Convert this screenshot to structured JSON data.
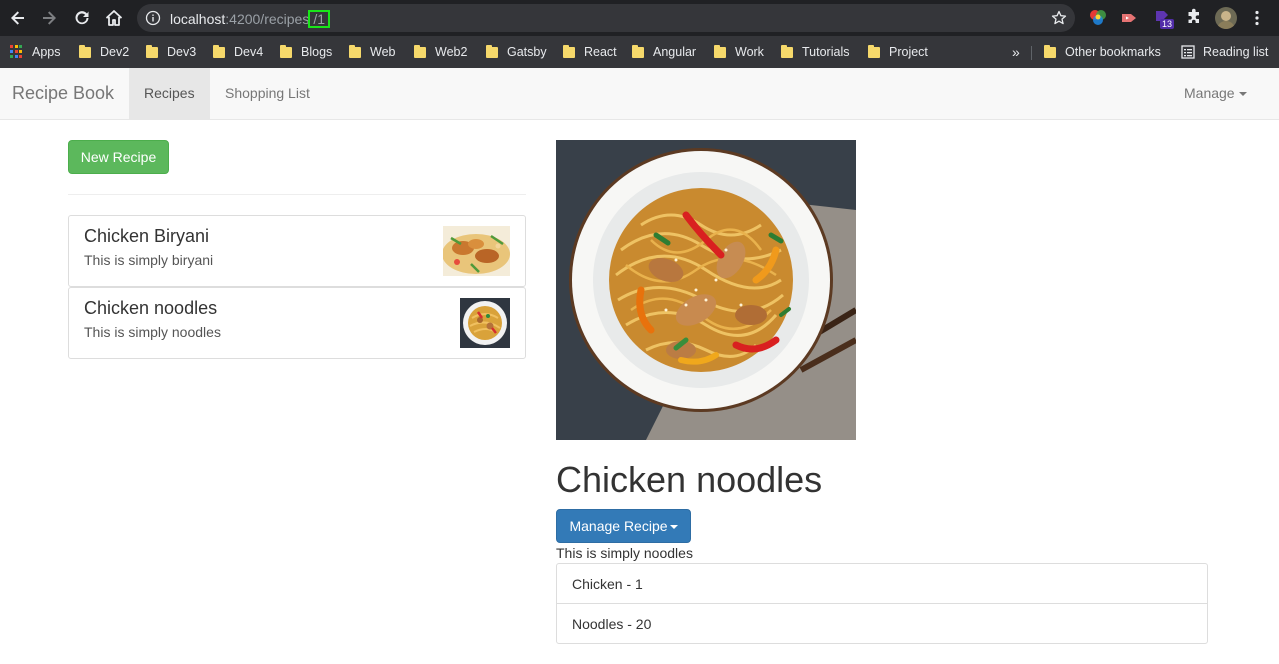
{
  "browser": {
    "url_host": "localhost",
    "url_path": ":4200/recipes",
    "url_highlight": "/1",
    "extension_badge": "13"
  },
  "bookmarks": {
    "apps": "Apps",
    "items": [
      "Dev2",
      "Dev3",
      "Dev4",
      "Blogs",
      "Web",
      "Web2",
      "Gatsby",
      "React",
      "Angular",
      "Work",
      "Tutorials",
      "Project"
    ],
    "overflow": "»",
    "other": "Other bookmarks",
    "reading_list": "Reading list"
  },
  "navbar": {
    "brand": "Recipe Book",
    "links": [
      "Recipes",
      "Shopping List"
    ],
    "manage": "Manage"
  },
  "recipes": {
    "new_button": "New Recipe",
    "items": [
      {
        "name": "Chicken Biryani",
        "description": "This is simply biryani"
      },
      {
        "name": "Chicken noodles",
        "description": "This is simply noodles"
      }
    ]
  },
  "detail": {
    "title": "Chicken noodles",
    "manage_button": "Manage Recipe",
    "description": "This is simply noodles",
    "ingredients": [
      "Chicken - 1",
      "Noodles - 20"
    ]
  },
  "colors": {
    "success": "#5cb85c",
    "primary": "#337ab7",
    "url_highlight_border": "#19e619"
  }
}
